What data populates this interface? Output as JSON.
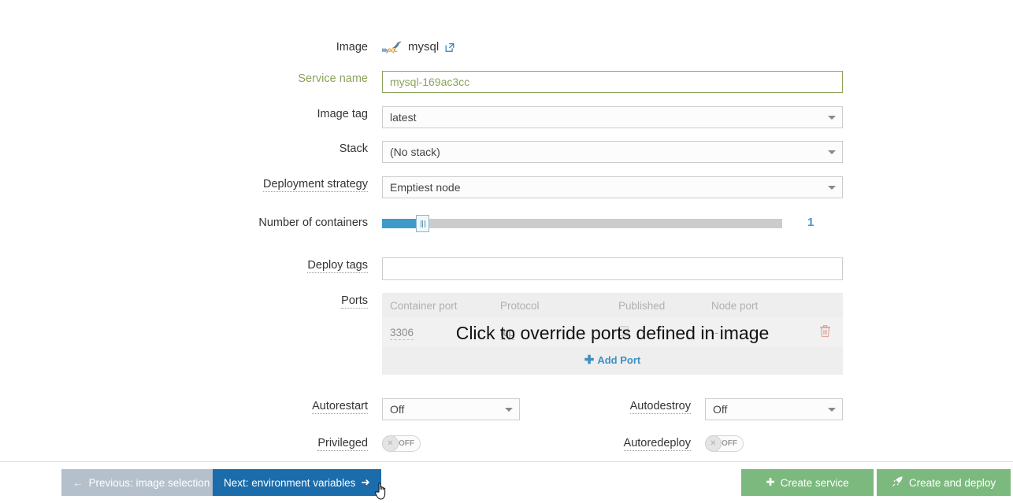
{
  "form": {
    "image": {
      "label": "Image",
      "value": "mysql",
      "logo_alt": "MySQL",
      "logo_text_my": "My",
      "logo_text_sql": "SQL",
      "external_link_icon": "external-link-icon"
    },
    "service_name": {
      "label": "Service name",
      "value": "mysql-169ac3cc",
      "placeholder": "",
      "valid_color": "#8aa35c"
    },
    "image_tag": {
      "label": "Image tag",
      "value": "latest"
    },
    "stack": {
      "label": "Stack",
      "value": "(No stack)"
    },
    "deployment_strategy": {
      "label": "Deployment strategy",
      "value": "Emptiest node"
    },
    "containers": {
      "label": "Number of containers",
      "value": "1",
      "min": 1,
      "max": 10,
      "fill_color": "#3e9ac9"
    },
    "deploy_tags": {
      "label": "Deploy tags",
      "value": "",
      "placeholder": ""
    },
    "ports": {
      "label": "Ports",
      "overlay_message": "Click to override ports defined in image",
      "columns": [
        "Container port",
        "Protocol",
        "Published",
        "Node port"
      ],
      "rows": [
        {
          "container_port": "3306",
          "protocol": "tcp",
          "published": false,
          "node_port": "--",
          "delete_icon": "trash-icon"
        }
      ],
      "add_port_label": "Add Port",
      "add_icon": "plus-icon"
    },
    "autorestart": {
      "label": "Autorestart",
      "value": "Off"
    },
    "autodestroy": {
      "label": "Autodestroy",
      "value": "Off"
    },
    "privileged": {
      "label": "Privileged",
      "state": "OFF"
    },
    "autoredeploy": {
      "label": "Autoredeploy",
      "state": "OFF"
    }
  },
  "footer": {
    "previous": {
      "label": "Previous: image selection",
      "icon": "arrow-left-icon",
      "color": "#b4c0cb"
    },
    "next": {
      "label": "Next: environment variables",
      "icon": "arrow-right-icon",
      "color": "#1b6cab"
    },
    "create_service": {
      "label": "Create service",
      "icon": "plus-icon",
      "color": "#7cb97e"
    },
    "create_and_deploy": {
      "label": "Create and deploy",
      "icon": "rocket-icon",
      "color": "#7cb97e"
    }
  },
  "cursor": {
    "icon": "pointer-hand-cursor"
  }
}
